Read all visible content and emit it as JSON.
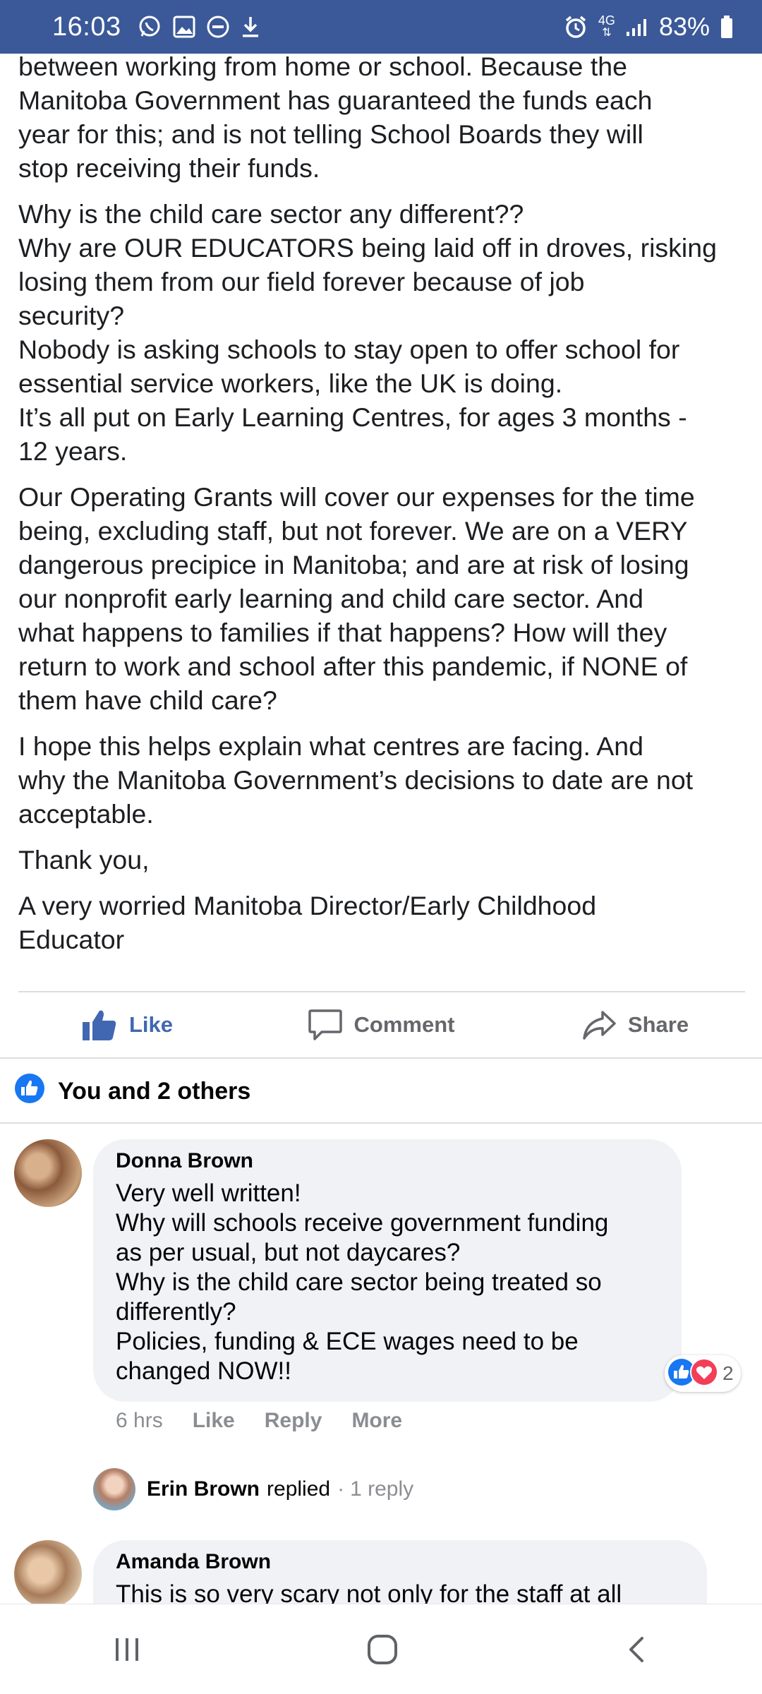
{
  "status_bar": {
    "time": "16:03",
    "network": "4G",
    "battery": "83%",
    "icons_left": [
      "whatsapp-icon",
      "gallery-icon",
      "do-not-disturb-icon",
      "download-icon"
    ],
    "icons_right": [
      "alarm-icon",
      "network-4g-icon",
      "signal-icon",
      "battery-icon"
    ],
    "color": "#3b5998"
  },
  "post": {
    "paragraphs": [
      "between working from home or school. Because the\nManitoba Government has guaranteed the funds each\nyear for this; and is not telling School Boards they will\nstop receiving their funds.",
      "Why is the child care sector any different??\nWhy are OUR EDUCATORS being laid off in droves, risking\nlosing them from our field forever because of job\nsecurity?\nNobody is asking schools to stay open to offer school for\nessential service workers, like the UK is doing.\nIt’s all put on Early Learning Centres, for ages 3 months -\n12 years.",
      "Our Operating Grants will cover our expenses for the time\nbeing, excluding staff, but not forever. We are on a VERY\ndangerous precipice in Manitoba; and are at risk of losing\nour nonprofit early learning and child care sector. And\nwhat happens to families if that happens? How will they\nreturn to work and school after this pandemic, if NONE of\nthem have child care?",
      "I hope this helps explain what centres are facing. And\nwhy the Manitoba Government’s decisions to date are not\nacceptable.",
      "Thank you,",
      "A very worried Manitoba Director/Early Childhood\nEducator"
    ]
  },
  "actions": {
    "like_label": "Like",
    "comment_label": "Comment",
    "share_label": "Share",
    "like_color": "#4267b2"
  },
  "reactions_summary": {
    "text": "You and 2 others"
  },
  "comments": [
    {
      "author": "Donna Brown",
      "text": "Very well written!\nWhy will schools receive government funding\nas per usual, but not daycares?\nWhy is the child care sector being treated so\ndifferently?\nPolicies, funding & ECE wages need to be\nchanged NOW!!",
      "time": "6 hrs",
      "like_label": "Like",
      "reply_label": "Reply",
      "more_label": "More",
      "reaction_count": "2",
      "reaction_icons": [
        "like-reaction-icon",
        "love-reaction-icon"
      ],
      "reply_summary": {
        "author": "Erin Brown",
        "verb": "replied",
        "separator": "·",
        "count": "1 reply"
      }
    },
    {
      "author": "Amanda Brown",
      "text": "This is so very scary not only for the staff at all"
    }
  ],
  "nav_bar": {
    "icons": [
      "recent-apps-icon",
      "home-icon",
      "back-icon"
    ]
  }
}
